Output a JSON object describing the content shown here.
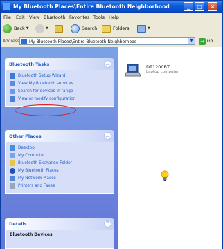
{
  "window": {
    "title": "My Bluetooth Places\\Entire Bluetooth Neighborhood",
    "controls": {
      "minimize": "_",
      "maximize": "□",
      "close": "×"
    }
  },
  "menu": [
    "File",
    "Edit",
    "View",
    "Bluetooth",
    "Favorites",
    "Tools",
    "Help"
  ],
  "toolbar": {
    "back_label": "Back",
    "search_label": "Search",
    "folders_label": "Folders"
  },
  "address": {
    "label": "Address",
    "value": "My Bluetooth Places\\Entire Bluetooth Neighborhood",
    "go_label": "Go"
  },
  "task_panels": {
    "bluetooth_tasks": {
      "title": "Bluetooth Tasks",
      "items": [
        {
          "label": "Bluetooth Setup Wizard",
          "icon": "wizard-icon"
        },
        {
          "label": "View My Bluetooth services",
          "icon": "services-icon"
        },
        {
          "label": "Search for devices in range",
          "icon": "search-devices-icon"
        },
        {
          "label": "View or modify configuration",
          "icon": "configuration-icon"
        }
      ]
    },
    "other_places": {
      "title": "Other Places",
      "items": [
        {
          "label": "Desktop",
          "icon": "desktop-icon"
        },
        {
          "label": "My Computer",
          "icon": "my-computer-icon"
        },
        {
          "label": "Bluetooth Exchange Folder",
          "icon": "folder-icon"
        },
        {
          "label": "My Bluetooth Places",
          "icon": "bluetooth-icon"
        },
        {
          "label": "My Network Places",
          "icon": "network-icon"
        },
        {
          "label": "Printers and Faxes",
          "icon": "printer-icon"
        }
      ]
    },
    "details": {
      "title": "Details",
      "name": "Bluetooth Devices"
    }
  },
  "content": {
    "device": {
      "name": "DT1200BT",
      "subtitle": "Laptop computer",
      "icon": "laptop-icon"
    }
  },
  "colors": {
    "titlebar": "#0a5ad8",
    "taskpane": "#6f8ee0",
    "link": "#215dc6",
    "highlight": "#d42020"
  }
}
